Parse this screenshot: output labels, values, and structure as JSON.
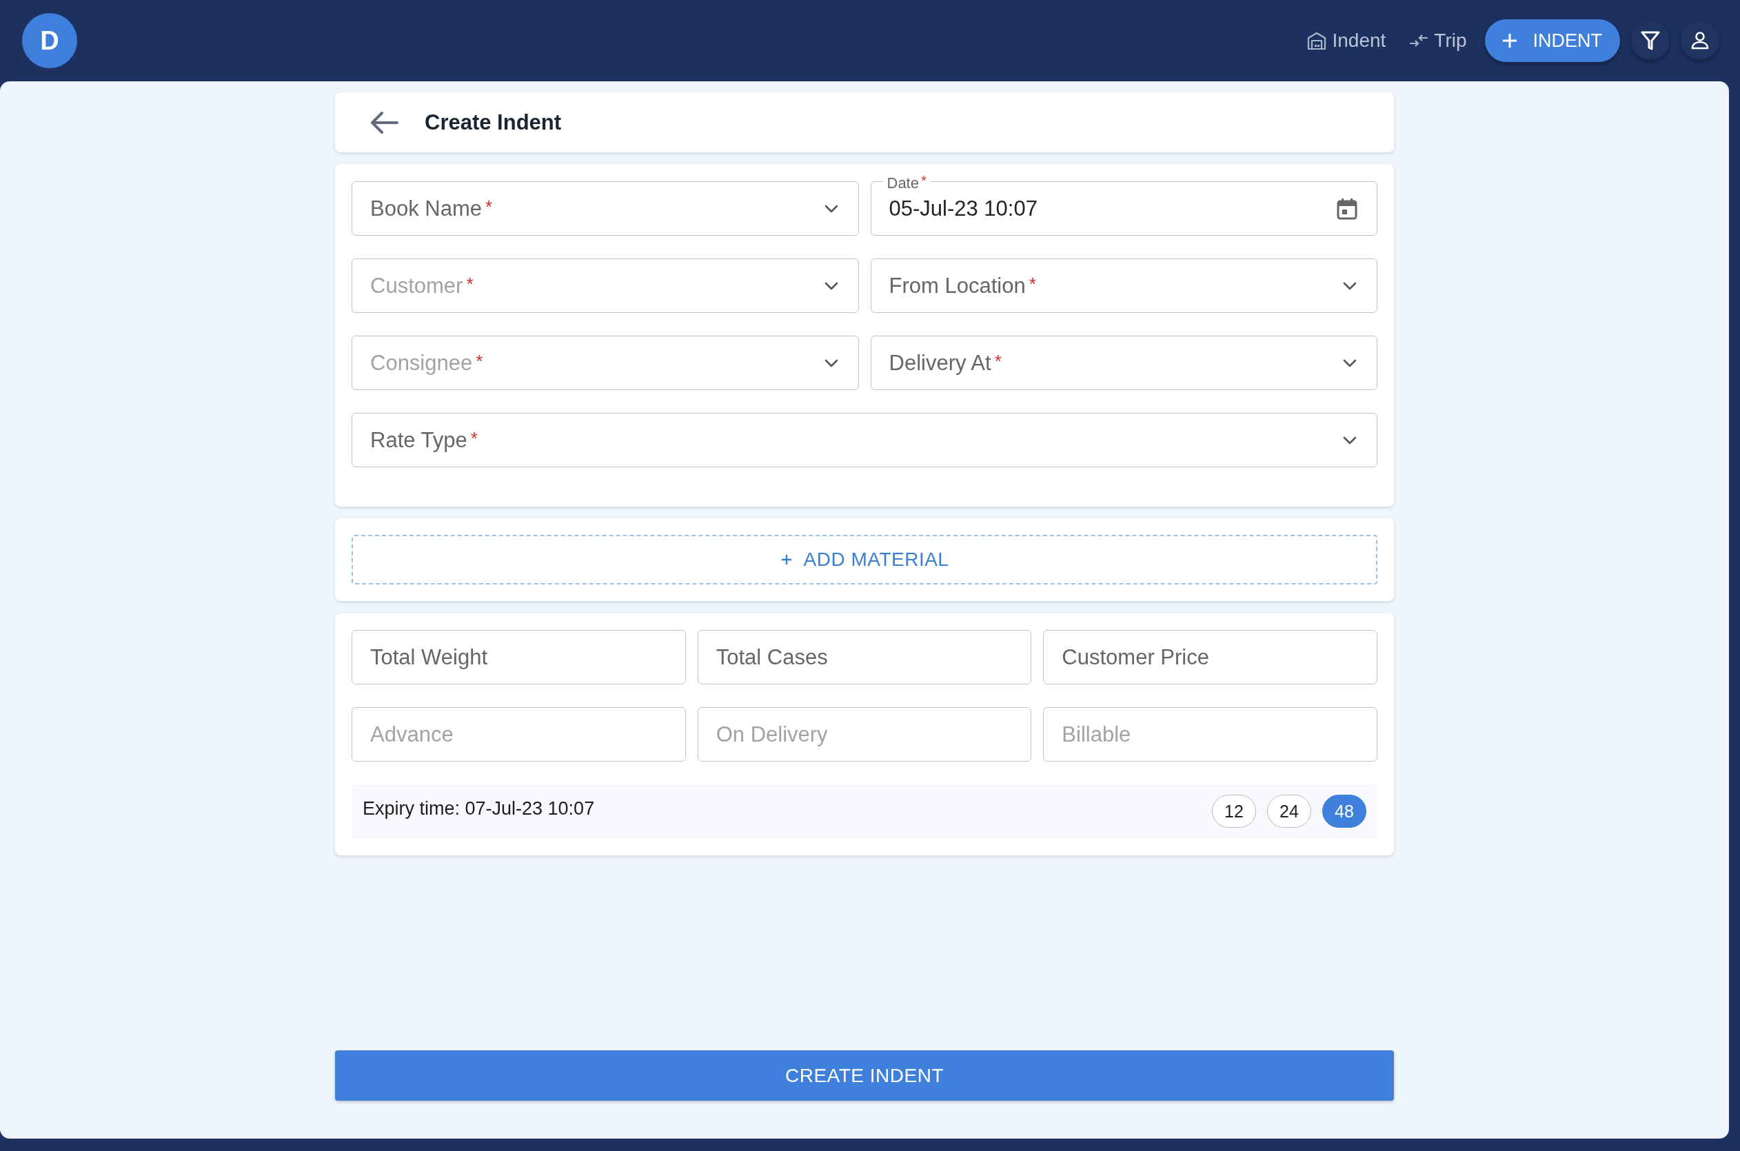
{
  "avatar": "D",
  "nav": [
    {
      "kind": "indent",
      "label": "Indent"
    },
    {
      "kind": "trip",
      "label": "Trip"
    }
  ],
  "new_button": {
    "label": "INDENT"
  },
  "header": {
    "title": "Create Indent"
  },
  "form_rows": [
    [
      {
        "kind": "select",
        "label": "Book Name",
        "required_mark": "*",
        "disabled": false
      },
      {
        "kind": "date",
        "label": "Date",
        "required_mark": "*",
        "value": "05-Jul-23 10:07",
        "disabled": false
      }
    ],
    [
      {
        "kind": "select",
        "label": "Customer",
        "required_mark": "*",
        "disabled": true
      },
      {
        "kind": "select",
        "label": "From Location",
        "required_mark": "*",
        "disabled": false
      }
    ],
    [
      {
        "kind": "select",
        "label": "Consignee",
        "required_mark": "*",
        "disabled": true
      },
      {
        "kind": "select",
        "label": "Delivery At",
        "required_mark": "*",
        "disabled": false
      }
    ],
    [
      {
        "kind": "select",
        "label": "Rate Type",
        "required_mark": "*",
        "disabled": false
      }
    ]
  ],
  "add_material": {
    "label": "ADD MATERIAL"
  },
  "amount_rows": [
    [
      {
        "kind": "text",
        "label": "Total Weight",
        "disabled": false
      },
      {
        "kind": "text",
        "label": "Total Cases",
        "disabled": false
      },
      {
        "kind": "text",
        "label": "Customer Price",
        "disabled": false
      }
    ],
    [
      {
        "kind": "text",
        "label": "Advance",
        "disabled": true
      },
      {
        "kind": "text",
        "label": "On Delivery",
        "disabled": true
      },
      {
        "kind": "text",
        "label": "Billable",
        "disabled": true
      }
    ]
  ],
  "expiry": {
    "text": "Expiry time: 07-Jul-23 10:07",
    "options": [
      {
        "label": "12",
        "selected": false
      },
      {
        "label": "24",
        "selected": false
      },
      {
        "label": "48",
        "selected": true
      }
    ]
  },
  "submit": {
    "label": "CREATE INDENT"
  }
}
